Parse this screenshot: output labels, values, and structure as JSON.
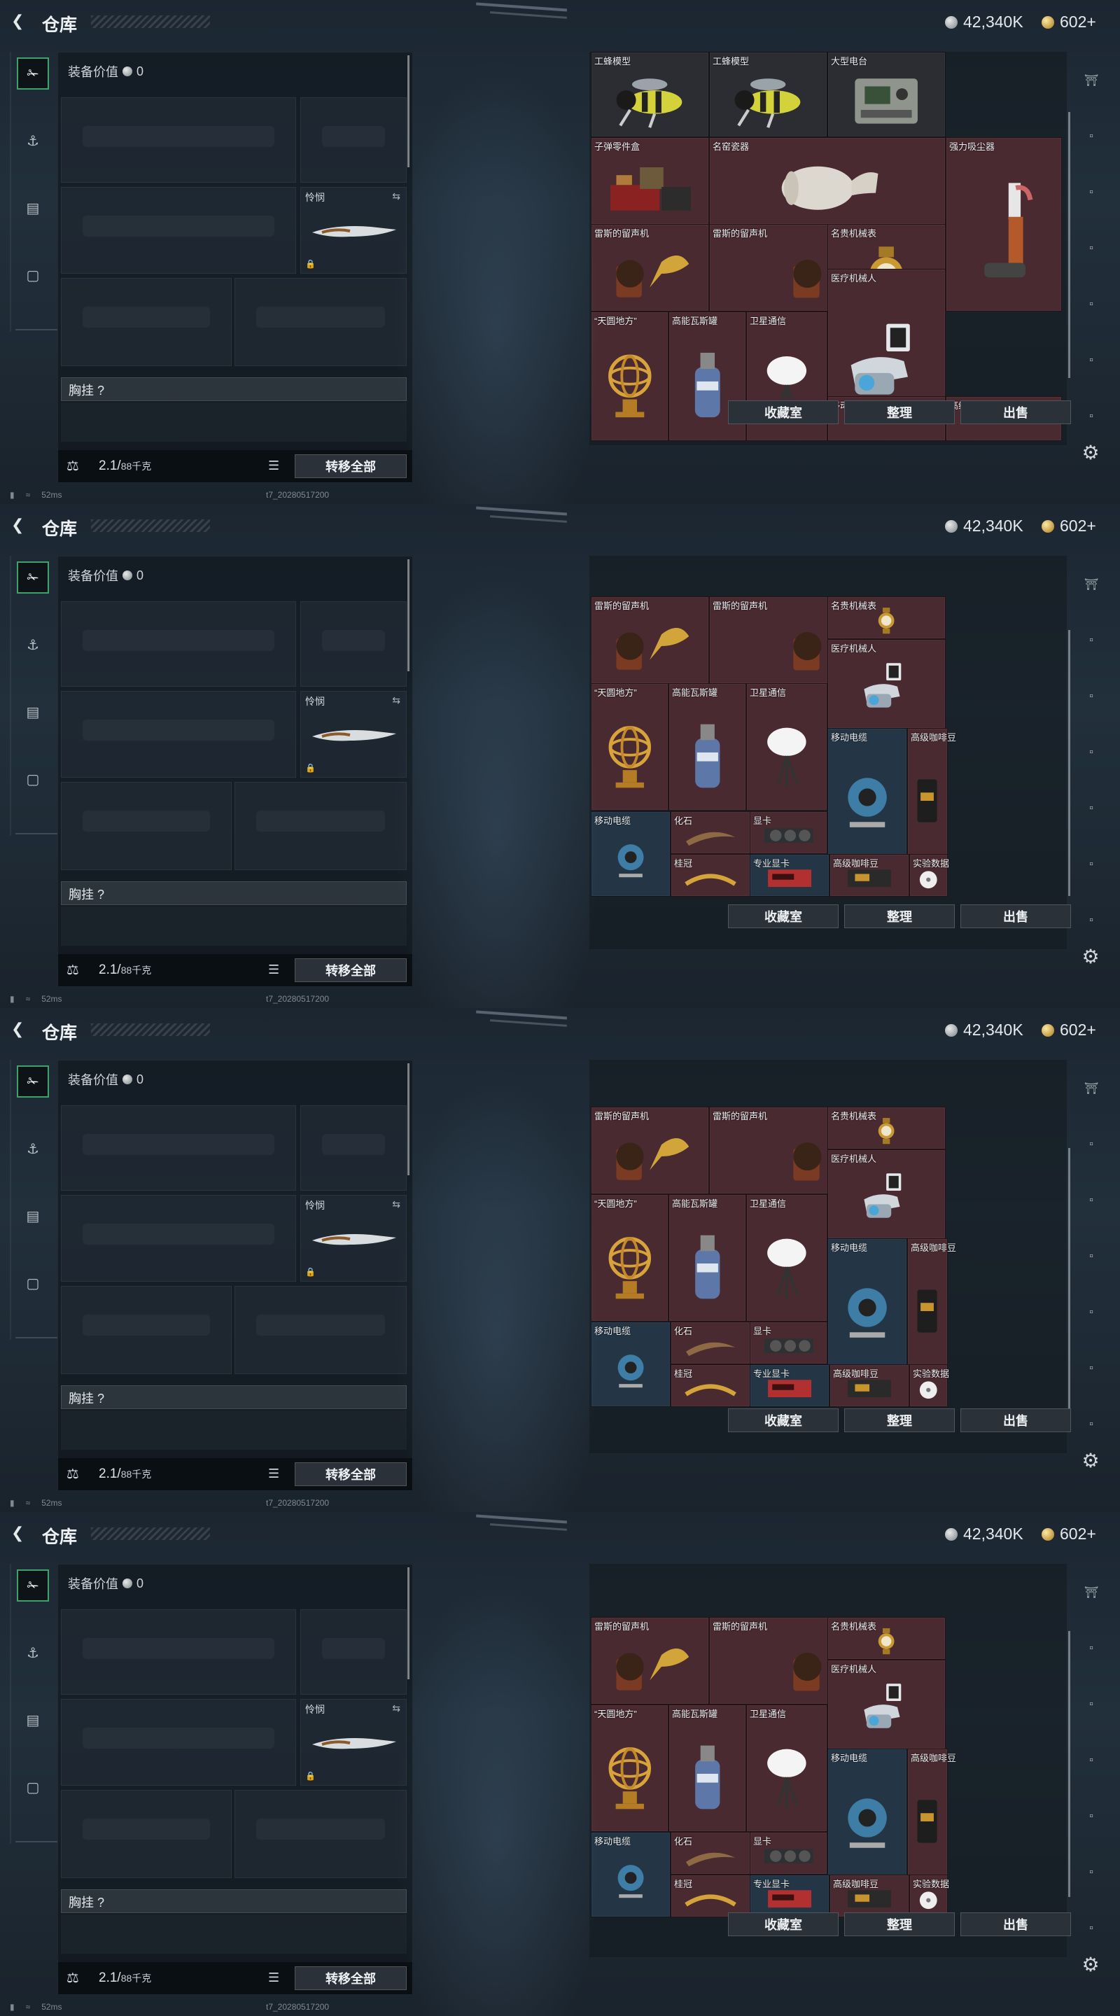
{
  "header": {
    "title": "仓库",
    "currency_silver": "42,340K",
    "currency_gold": "602+"
  },
  "left_panel": {
    "equip_value_label": "装备价值",
    "equip_value": "0",
    "melee_label": "怜悯",
    "chest_label": "胸挂 ?",
    "weight": "2.1/",
    "weight_cap": "88千克",
    "transfer_all": "转移全部"
  },
  "right_panel": {
    "buttons": {
      "collection": "收藏室",
      "sort": "整理",
      "sell": "出售"
    }
  },
  "status": {
    "ping": "52ms",
    "session": "t7_20280517200"
  },
  "frames": [
    {
      "items": [
        {
          "label": "工蜂模型"
        },
        {
          "label": "工蜂模型"
        },
        {
          "label": "大型电台"
        },
        {
          "label": "子弹零件盒"
        },
        {
          "label": "名窑瓷器"
        },
        {
          "label": "强力吸尘器"
        },
        {
          "label": "雷斯的留声机"
        },
        {
          "label": "雷斯的留声机"
        },
        {
          "label": "名贵机械表"
        },
        {
          "label": "医疗机械人"
        },
        {
          "label": "“天圆地方”"
        },
        {
          "label": "高能瓦斯罐"
        },
        {
          "label": "卫星通信"
        },
        {
          "label": "移动电缆"
        },
        {
          "label": "高级咖啡豆"
        }
      ]
    },
    {
      "items": [
        {
          "label": "雷斯的留声机"
        },
        {
          "label": "雷斯的留声机"
        },
        {
          "label": "名贵机械表"
        },
        {
          "label": "医疗机械人"
        },
        {
          "label": "“天圆地方”"
        },
        {
          "label": "高能瓦斯罐"
        },
        {
          "label": "卫星通信"
        },
        {
          "label": "移动电缆"
        },
        {
          "label": "高级咖啡豆"
        },
        {
          "label": "移动电缆"
        },
        {
          "label": "化石"
        },
        {
          "label": "显卡"
        },
        {
          "label": "桂冠"
        },
        {
          "label": "专业显卡"
        },
        {
          "label": "高级咖啡豆"
        },
        {
          "label": "实验数据"
        }
      ]
    }
  ]
}
